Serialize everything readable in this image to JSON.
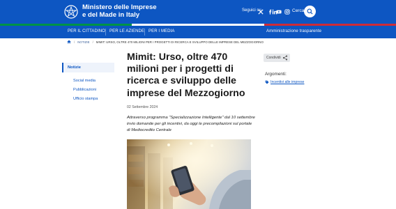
{
  "header": {
    "brand_line1": "Ministero delle Imprese",
    "brand_line2": "e del Made in Italy",
    "social_label": "Seguici su",
    "social_icons": [
      "x-icon",
      "facebook-icon",
      "youtube-icon",
      "instagram-icon",
      "linkedin-icon"
    ],
    "search_label": "Cerca",
    "colors": {
      "primary": "#0d56c2",
      "flag_green": "#009246",
      "flag_white": "#ffffff",
      "flag_red": "#ce2b37"
    }
  },
  "nav": {
    "items": [
      "PER IL CITTADINO",
      "PER LE AZIENDE",
      "PER I MEDIA"
    ],
    "right_link": "Amministrazione trasparente"
  },
  "breadcrumb": {
    "home_icon": "home-icon",
    "items": [
      "NOTIZIE",
      "MIMIT: URSO, OLTRE 470 MILIONI PER I PROGETTI DI RICERCA E SVILUPPO DELLE IMPRESE DEL MEZZOGIORNO"
    ]
  },
  "sidebar": {
    "active": "Notizie",
    "links": [
      "Social media",
      "Pubblicazioni",
      "Ufficio stampa"
    ]
  },
  "article": {
    "title": "Mimit: Urso, oltre 470 milioni per i progetti di ricerca e sviluppo delle imprese del Mezzogiorno",
    "date": "02 Settembre 2024",
    "lead": "Attraverso programma \"Specializzazione Intelligente\" dal 10 settembre invio domande per gli incentivi, da oggi le precompilazioni sul portale di Mediocredito Centrale"
  },
  "aside": {
    "share_label": "Condividi",
    "topics_title": "Argomenti:",
    "topic_link": "Incentivi alle imprese"
  }
}
